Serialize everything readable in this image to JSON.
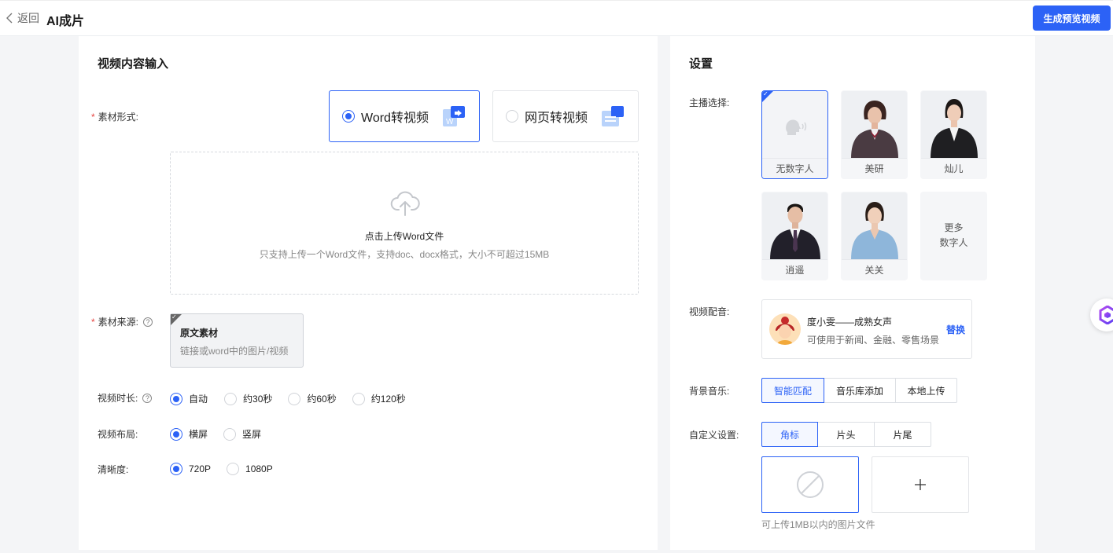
{
  "header": {
    "back_label": "返回",
    "title": "AI成片",
    "generate_button": "生成预览视频"
  },
  "left": {
    "section_title": "视频内容输入",
    "material_form": {
      "label": "素材形式:",
      "options": [
        {
          "label": "Word转视频",
          "selected": true
        },
        {
          "label": "网页转视频",
          "selected": false
        }
      ]
    },
    "upload": {
      "title": "点击上传Word文件",
      "hint": "只支持上传一个Word文件，支持doc、docx格式，大小不可超过15MB"
    },
    "material_source": {
      "label": "素材来源:",
      "card_title": "原文素材",
      "card_desc": "链接或word中的图片/视频"
    },
    "duration": {
      "label": "视频时长:",
      "options": [
        "自动",
        "约30秒",
        "约60秒",
        "约120秒"
      ],
      "selected": "自动"
    },
    "layout": {
      "label": "视频布局:",
      "options": [
        "横屏",
        "竖屏"
      ],
      "selected": "横屏"
    },
    "resolution": {
      "label": "清晰度:",
      "options": [
        "720P",
        "1080P"
      ],
      "selected": "720P"
    }
  },
  "right": {
    "section_title": "设置",
    "anchor": {
      "label": "主播选择:",
      "items": [
        {
          "name": "无数字人",
          "selected": true
        },
        {
          "name": "美研",
          "selected": false
        },
        {
          "name": "灿儿",
          "selected": false
        },
        {
          "name": "逍遥",
          "selected": false
        },
        {
          "name": "关关",
          "selected": false
        }
      ],
      "more_line1": "更多",
      "more_line2": "数字人"
    },
    "voice": {
      "label": "视频配音:",
      "name": "度小雯——成熟女声",
      "desc": "可使用于新闻、金融、零售场景",
      "replace": "替换"
    },
    "bgm": {
      "label": "背景音乐:",
      "options": [
        "智能匹配",
        "音乐库添加",
        "本地上传"
      ],
      "selected": "智能匹配"
    },
    "custom": {
      "label": "自定义设置:",
      "tabs": [
        "角标",
        "片头",
        "片尾"
      ],
      "selected": "角标",
      "upload_note": "可上传1MB以内的图片文件"
    }
  },
  "colors": {
    "accent": "#2c62f6",
    "required": "#e64340",
    "background": "#f4f5f7"
  }
}
